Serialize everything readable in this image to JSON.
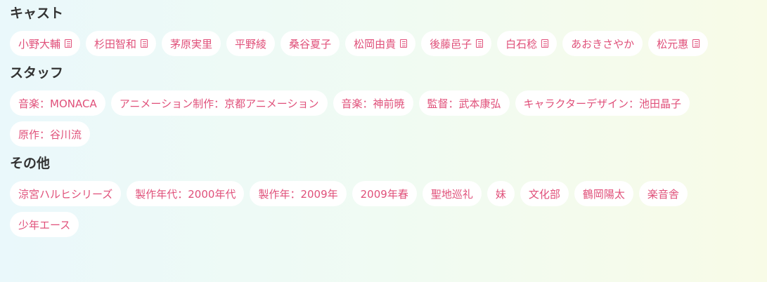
{
  "cast": {
    "title": "キャスト",
    "items": [
      {
        "label": "小野大輔",
        "doc": true
      },
      {
        "label": "杉田智和",
        "doc": true
      },
      {
        "label": "茅原実里",
        "doc": false
      },
      {
        "label": "平野綾",
        "doc": false
      },
      {
        "label": "桑谷夏子",
        "doc": false
      },
      {
        "label": "松岡由貴",
        "doc": true
      },
      {
        "label": "後藤邑子",
        "doc": true
      },
      {
        "label": "白石稔",
        "doc": true
      },
      {
        "label": "あおきさやか",
        "doc": false
      },
      {
        "label": "松元惠",
        "doc": true
      }
    ]
  },
  "staff": {
    "title": "スタッフ",
    "items": [
      {
        "label": "音楽：MONACA"
      },
      {
        "label": "アニメーション制作：京都アニメーション"
      },
      {
        "label": "音楽：神前暁"
      },
      {
        "label": "監督：武本康弘"
      },
      {
        "label": "キャラクターデザイン：池田晶子"
      },
      {
        "label": "原作：谷川流"
      }
    ]
  },
  "other": {
    "title": "その他",
    "items": [
      {
        "label": "涼宮ハルヒシリーズ"
      },
      {
        "label": "製作年代：2000年代"
      },
      {
        "label": "製作年：2009年"
      },
      {
        "label": "2009年春"
      },
      {
        "label": "聖地巡礼"
      },
      {
        "label": "妹"
      },
      {
        "label": "文化部"
      },
      {
        "label": "鶴岡陽太"
      },
      {
        "label": "楽音舎"
      },
      {
        "label": "少年エース"
      }
    ]
  },
  "colors": {
    "tag_text": "#e0507a",
    "tag_bg": "#ffffff",
    "heading": "#333333"
  },
  "icons": {
    "doc": "document-icon"
  }
}
